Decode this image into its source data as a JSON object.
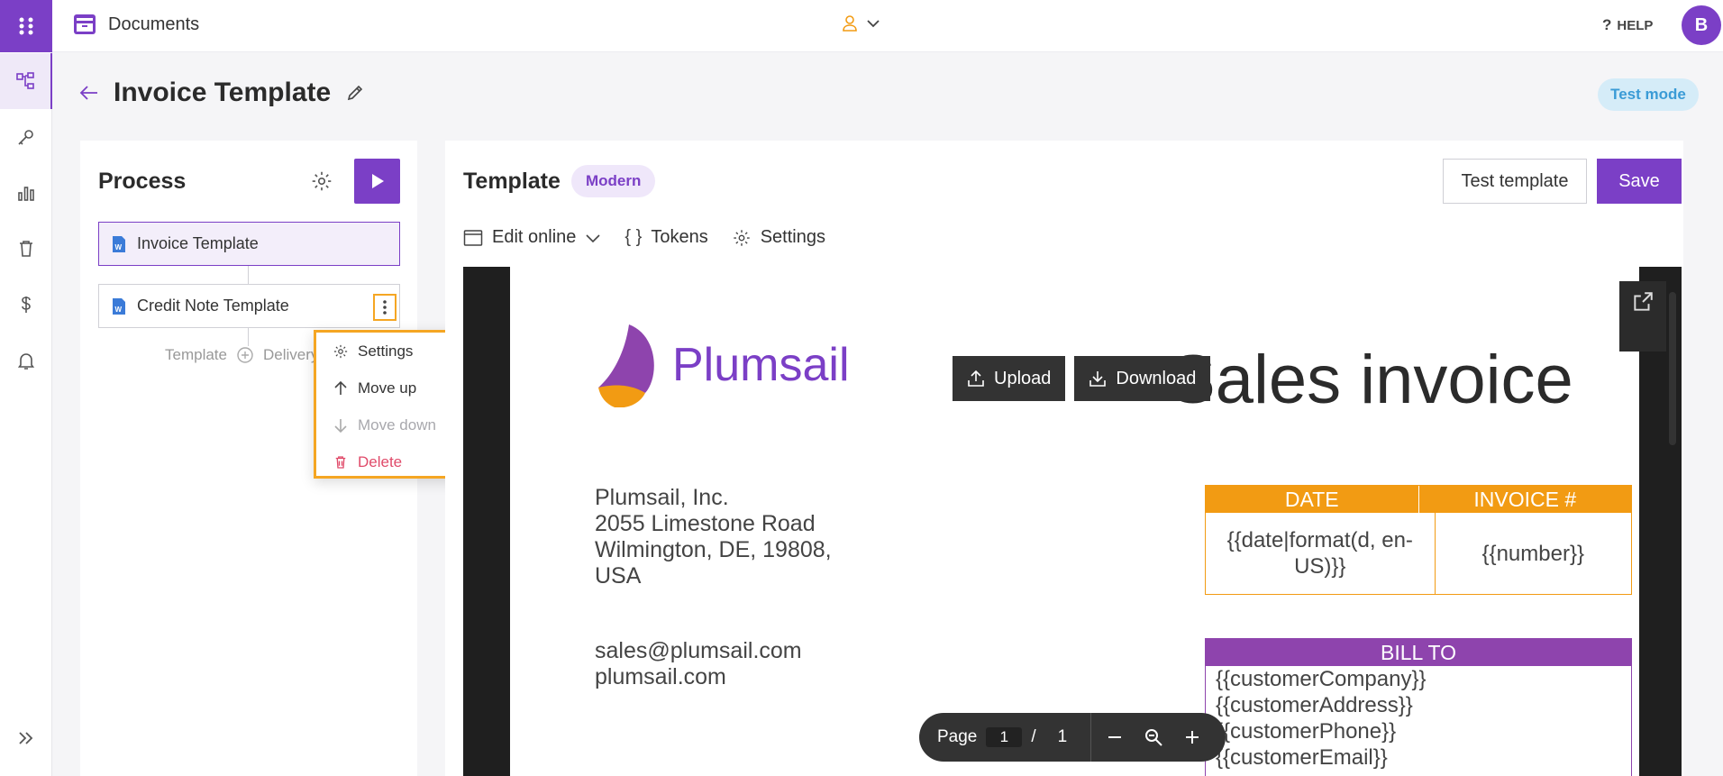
{
  "topbar": {
    "crumb": "Documents",
    "help": "HELP",
    "avatar_initial": "B"
  },
  "page": {
    "title": "Invoice Template",
    "test_mode": "Test mode"
  },
  "process": {
    "title": "Process",
    "steps": [
      {
        "label": "Invoice Template",
        "selected": true
      },
      {
        "label": "Credit Note Template",
        "selected": false
      }
    ],
    "add_template": "Template",
    "add_delivery": "Delivery",
    "menu": {
      "settings": "Settings",
      "move_up": "Move up",
      "move_down": "Move down",
      "delete": "Delete"
    }
  },
  "template": {
    "title": "Template",
    "badge": "Modern",
    "test_button": "Test template",
    "save_button": "Save",
    "tabs": {
      "edit": "Edit online",
      "tokens": "Tokens",
      "settings": "Settings"
    }
  },
  "document": {
    "logo_text": "Plumsail",
    "title": "Sales invoice",
    "upload": "Upload",
    "download": "Download",
    "address": [
      "Plumsail, Inc.",
      "2055 Limestone Road",
      "Wilmington, DE, 19808,",
      "USA"
    ],
    "contact": [
      "sales@plumsail.com",
      "plumsail.com"
    ],
    "date_header": "DATE",
    "invoice_header": "INVOICE #",
    "date_value": "{{date|format(d, en-US)}}",
    "invoice_value": "{{number}}",
    "bill_to": "BILL TO",
    "bill_lines": [
      "{{customerCompany}}",
      "{{customerAddress}}",
      "{{customerPhone}}",
      "{{customerEmail}}"
    ]
  },
  "pager": {
    "label": "Page",
    "current": "1",
    "slash": "/",
    "total": "1"
  },
  "colors": {
    "accent": "#7b3fc6",
    "orange": "#f29b13",
    "purple_table": "#8e44ad",
    "danger": "#e04b6a"
  }
}
